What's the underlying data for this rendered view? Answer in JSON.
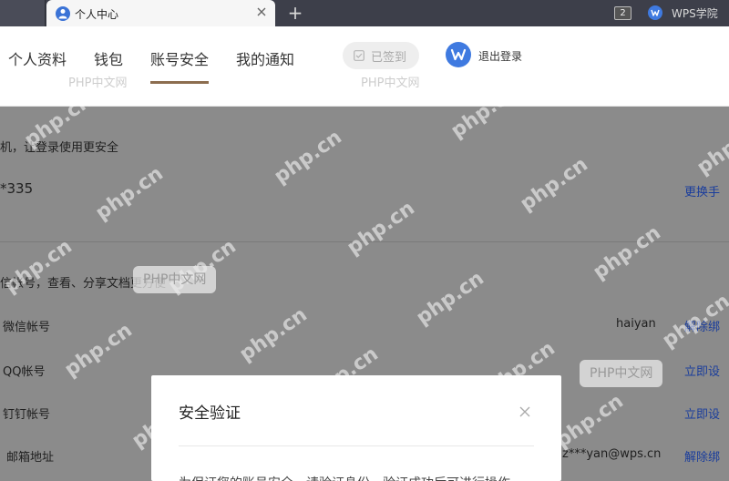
{
  "browser": {
    "tab_title": "个人中心",
    "tab_count": "2",
    "app_label": "WPS学院"
  },
  "nav": {
    "items": [
      "个人资料",
      "钱包",
      "账号安全",
      "我的通知"
    ],
    "active_index": 2,
    "signed_in_label": "已签到",
    "logout_label": "退出登录"
  },
  "security": {
    "phone_hint": "机，让登录使用更安全",
    "phone_masked": "*335",
    "change_phone_link": "更换手",
    "bind_hint": "信帐号，查看、分享文档更方便",
    "accounts": [
      {
        "label": "微信帐号",
        "value": "haiyan",
        "action": "解除绑"
      },
      {
        "label": "QQ帐号",
        "value": "",
        "action": "立即设"
      },
      {
        "label": "钉钉帐号",
        "value": "",
        "action": "立即设"
      },
      {
        "label": "邮箱地址",
        "value": "z***yan@wps.cn",
        "action": "解除绑"
      }
    ]
  },
  "modal": {
    "title": "安全验证",
    "body": "为保证您的账号安全，请验证身份，验证成功后可进行操作"
  },
  "watermarks": {
    "site_text": "php.cn",
    "box_text": "PHP中文网"
  },
  "colors": {
    "accent": "#8c6d4f",
    "brand_blue": "#3f7ae0",
    "link": "#1a3d9c",
    "overlay": "#8b8b8b"
  }
}
